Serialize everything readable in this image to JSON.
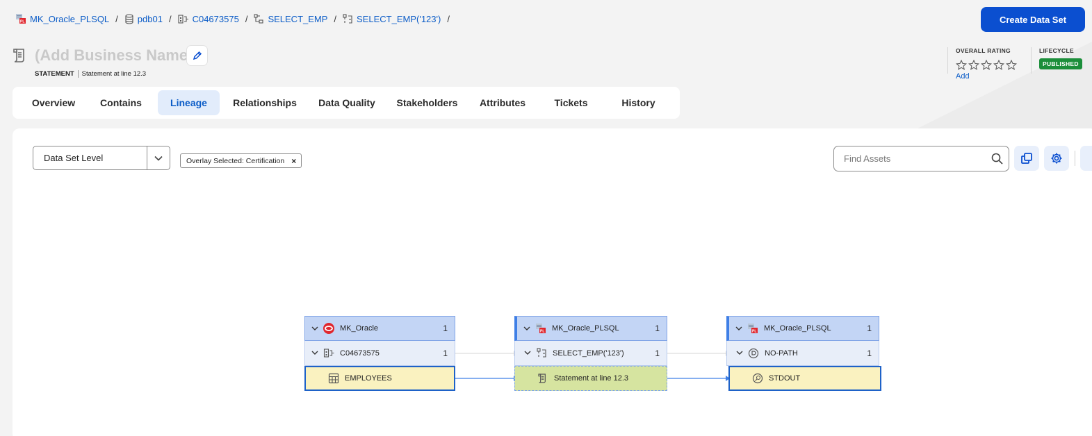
{
  "breadcrumb": [
    {
      "label": "MK_Oracle_PLSQL",
      "icon": "plsql-resource-icon"
    },
    {
      "label": "pdb01",
      "icon": "database-icon"
    },
    {
      "label": "C04673575",
      "icon": "schema-icon"
    },
    {
      "label": "SELECT_EMP",
      "icon": "procedure-icon"
    },
    {
      "label": "SELECT_EMP('123')",
      "icon": "procedure-call-icon"
    }
  ],
  "create_button": "Create Data Set",
  "header": {
    "title": "(Add Business Name)",
    "type": "STATEMENT",
    "subtitle": "Statement at line 12.3",
    "rating_label": "OVERALL RATING",
    "rating_value": 0,
    "rating_add": "Add",
    "lifecycle_label": "LIFECYCLE",
    "lifecycle_value": "PUBLISHED",
    "lifecycle_color": "#1b8e3a"
  },
  "tabs": [
    {
      "label": "Overview",
      "active": false
    },
    {
      "label": "Contains",
      "active": false
    },
    {
      "label": "Lineage",
      "active": true
    },
    {
      "label": "Relationships",
      "active": false
    },
    {
      "label": "Data Quality",
      "active": false
    },
    {
      "label": "Stakeholders",
      "active": false
    },
    {
      "label": "Attributes",
      "active": false
    },
    {
      "label": "Tickets",
      "active": false
    },
    {
      "label": "History",
      "active": false
    }
  ],
  "toolbar": {
    "level": "Data Set Level",
    "overlay_chip": "Overlay Selected: Certification",
    "search_placeholder": "Find Assets"
  },
  "lineage": {
    "nodes": [
      {
        "root": {
          "label": "MK_Oracle",
          "count": "1",
          "icon": "oracle-icon"
        },
        "group": {
          "label": "C04673575",
          "count": "1",
          "icon": "schema-icon"
        },
        "leaf": {
          "label": "EMPLOYEES",
          "icon": "table-icon"
        }
      },
      {
        "root": {
          "label": "MK_Oracle_PLSQL",
          "count": "1",
          "icon": "plsql-resource-icon"
        },
        "group": {
          "label": "SELECT_EMP('123')",
          "count": "1",
          "icon": "procedure-call-icon"
        },
        "leaf": {
          "label": "Statement at line 12.3",
          "icon": "statement-icon"
        }
      },
      {
        "root": {
          "label": "MK_Oracle_PLSQL",
          "count": "1",
          "icon": "plsql-resource-icon"
        },
        "group": {
          "label": "NO-PATH",
          "count": "1",
          "icon": "no-path-icon"
        },
        "leaf": {
          "label": "STDOUT",
          "icon": "output-icon"
        }
      }
    ]
  },
  "colors": {
    "accent": "#0b5cc7",
    "primary_button": "#0b4fd0",
    "tab_active_bg": "#e2ecfb",
    "leaf_yellow": "#faf2c0",
    "leaf_green": "#d6e4a0"
  }
}
